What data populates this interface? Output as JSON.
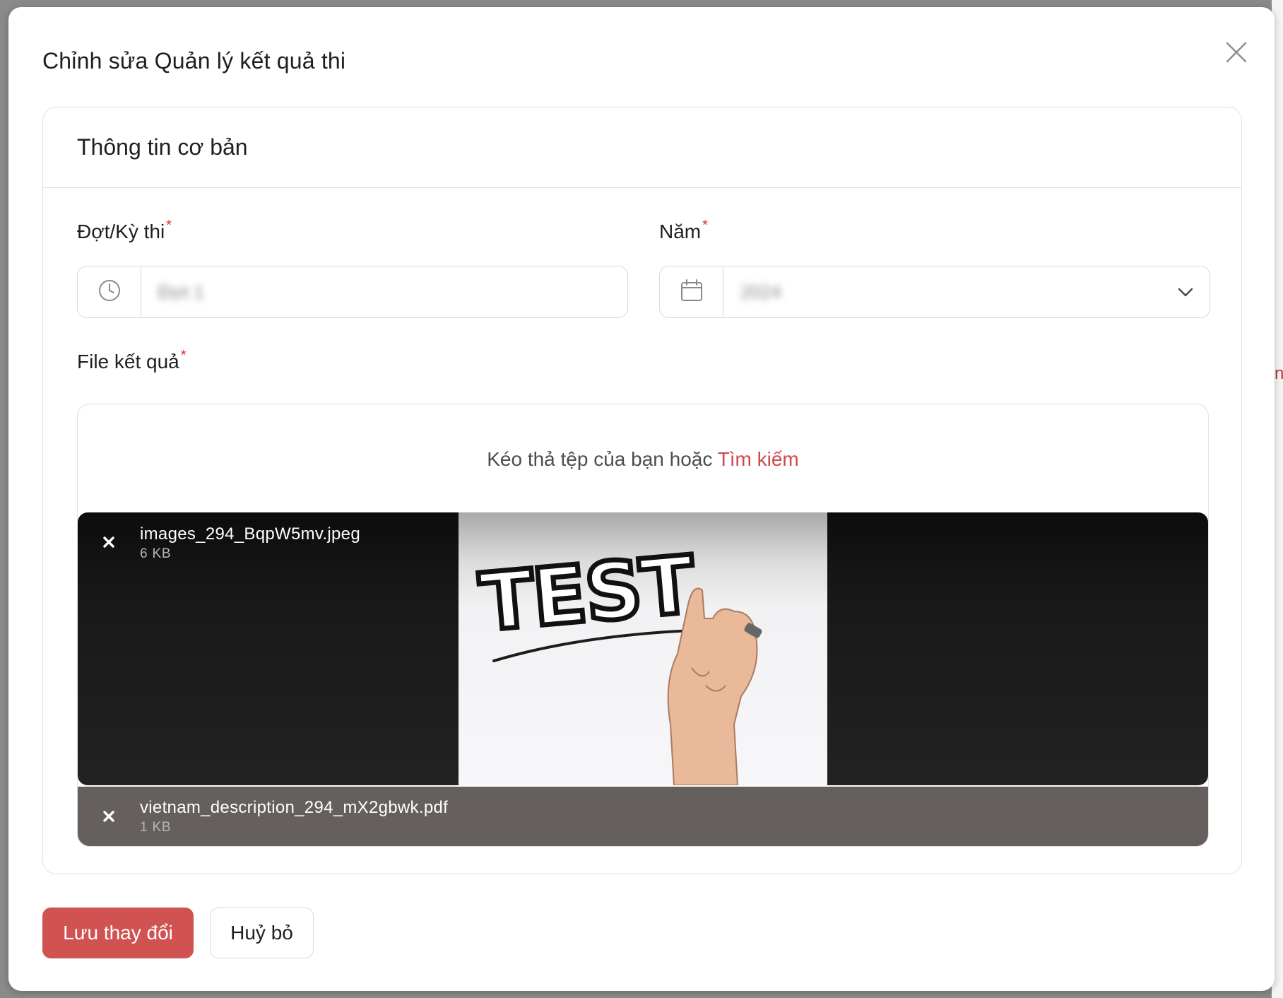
{
  "modal": {
    "title": "Chỉnh sửa Quản lý kết quả thi",
    "close_icon": "close-icon"
  },
  "card": {
    "title": "Thông tin cơ bản"
  },
  "form": {
    "exam_period": {
      "label": "Đợt/Kỳ thi",
      "required_mark": "*",
      "icon": "clock-icon",
      "value": "Đợt 1"
    },
    "year": {
      "label": "Năm",
      "required_mark": "*",
      "icon": "calendar-icon",
      "value": "2024",
      "dropdown_icon": "chevron-down-icon"
    },
    "result_file": {
      "label": "File kết quả",
      "required_mark": "*",
      "drop_hint": "Kéo thả tệp của bạn hoặc",
      "browse_label": "Tìm kiếm"
    }
  },
  "files": [
    {
      "name": "images_294_BqpW5mv.jpeg",
      "size": "6 KB",
      "type": "image"
    },
    {
      "name": "vietnam_description_294_mX2gbwk.pdf",
      "size": "1 KB",
      "type": "pdf"
    }
  ],
  "preview": {
    "image_text": "TEST"
  },
  "actions": {
    "save_label": "Lưu thay đổi",
    "cancel_label": "Huỷ bỏ"
  },
  "colors": {
    "primary": "#d05351",
    "required": "#e03131",
    "link": "#d0494a"
  }
}
